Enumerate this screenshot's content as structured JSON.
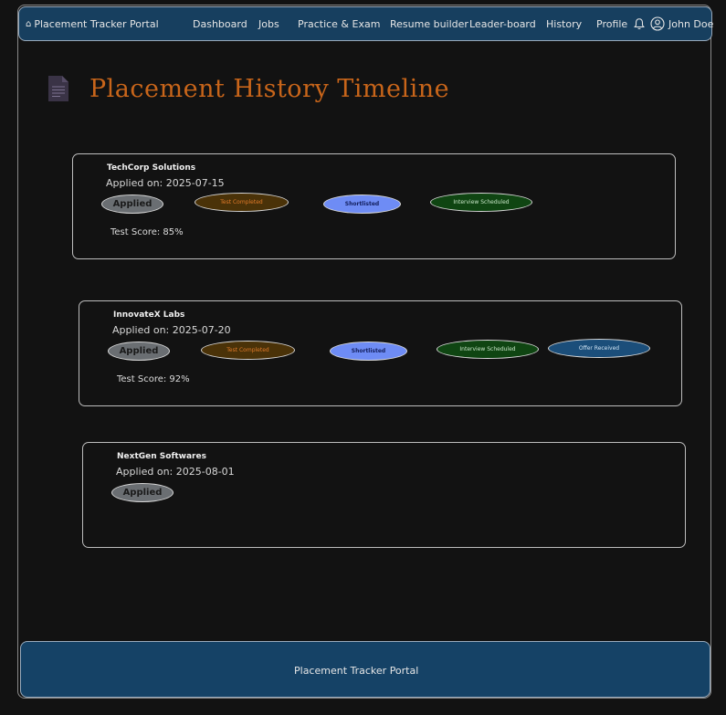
{
  "navbar": {
    "brand": "Placement Tracker Portal",
    "items": [
      "Dashboard",
      "Jobs",
      "Practice & Exam",
      "Resume builder",
      "Leader-board",
      "History",
      "Profile"
    ],
    "user_name": "John Doe"
  },
  "page": {
    "title": "Placement History Timeline"
  },
  "applications": [
    {
      "company": "TechCorp Solutions",
      "applied_on": "Applied on: 2025-07-15",
      "stages": [
        "Applied",
        "Test Completed",
        "Shortlisted",
        "Interview Scheduled"
      ],
      "score": "Test Score: 85%"
    },
    {
      "company": "InnovateX Labs",
      "applied_on": "Applied on: 2025-07-20",
      "stages": [
        "Applied",
        "Test Completed",
        "Shortlisted",
        "Interview Scheduled",
        "Offer Received"
      ],
      "score": "Test Score: 92%"
    },
    {
      "company": "NextGen Softwares",
      "applied_on": "Applied on: 2025-08-01",
      "stages": [
        "Applied"
      ]
    }
  ],
  "footer": {
    "text": "Placement Tracker Portal"
  },
  "colors": {
    "navbar_bg": "#173f5f",
    "title": "#c8651a",
    "applied": "#6a6e72",
    "test_completed": "#4a3208",
    "shortlisted": "#6e8cf5",
    "interview_scheduled": "#0f4512",
    "offer_received": "#1b4e7a"
  }
}
